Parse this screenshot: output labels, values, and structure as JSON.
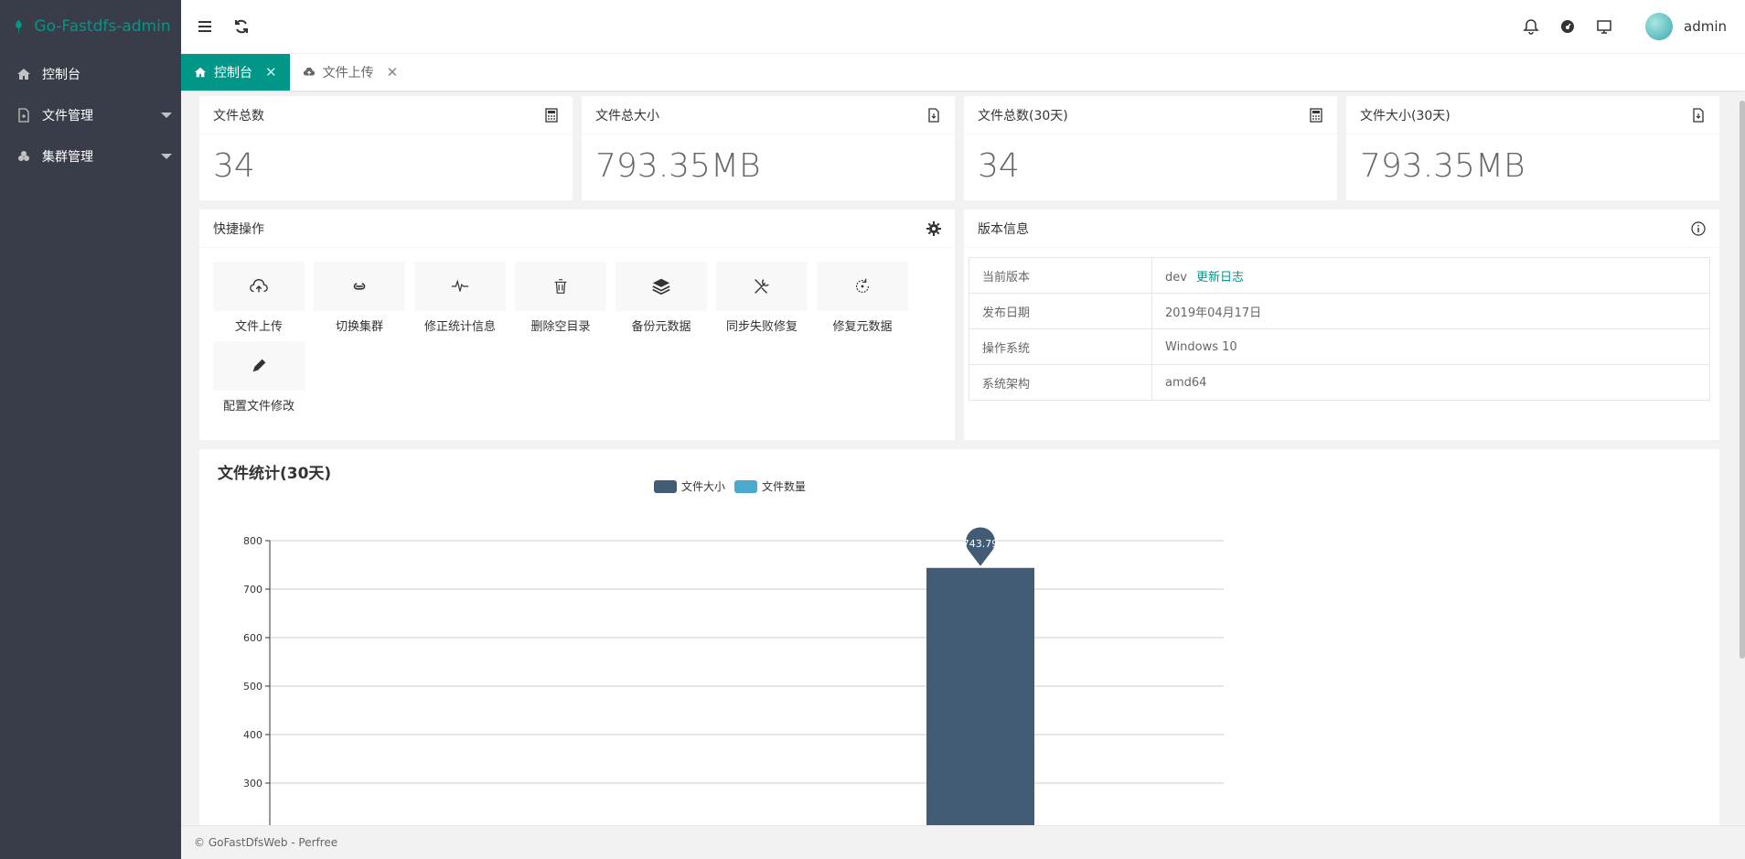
{
  "app": {
    "title": "Go-Fastdfs-admin"
  },
  "sidebar": {
    "items": [
      {
        "label": "控制台",
        "icon": "home-icon"
      },
      {
        "label": "文件管理",
        "icon": "file-icon",
        "expandable": true
      },
      {
        "label": "集群管理",
        "icon": "cluster-icon",
        "expandable": true
      }
    ]
  },
  "header": {
    "user": "admin"
  },
  "tabs": [
    {
      "label": "控制台",
      "active": true
    },
    {
      "label": "文件上传",
      "active": false
    }
  ],
  "stats": [
    {
      "label": "文件总数",
      "value": "34",
      "icon": "calculator-icon"
    },
    {
      "label": "文件总大小",
      "value": "793.35MB",
      "icon": "file-size-icon"
    },
    {
      "label": "文件总数(30天)",
      "value": "34",
      "icon": "calculator-icon"
    },
    {
      "label": "文件大小(30天)",
      "value": "793.35MB",
      "icon": "file-size-icon"
    }
  ],
  "quick": {
    "title": "快捷操作",
    "actions": [
      {
        "label": "文件上传",
        "icon": "cloud-upload-icon"
      },
      {
        "label": "切换集群",
        "icon": "link-icon"
      },
      {
        "label": "修正统计信息",
        "icon": "pulse-icon"
      },
      {
        "label": "删除空目录",
        "icon": "trash-icon"
      },
      {
        "label": "备份元数据",
        "icon": "layers-icon"
      },
      {
        "label": "同步失败修复",
        "icon": "tools-icon"
      },
      {
        "label": "修复元数据",
        "icon": "refresh-circle-icon"
      },
      {
        "label": "配置文件修改",
        "icon": "edit-icon"
      }
    ]
  },
  "version": {
    "title": "版本信息",
    "rows": [
      {
        "key": "当前版本",
        "value": "dev",
        "link": "更新日志"
      },
      {
        "key": "发布日期",
        "value": "2019年04月17日"
      },
      {
        "key": "操作系统",
        "value": "Windows 10"
      },
      {
        "key": "系统架构",
        "value": "amd64"
      }
    ]
  },
  "chart_data": {
    "type": "bar",
    "title": "文件统计(30天)",
    "series": [
      {
        "name": "文件大小",
        "values": [
          743.79
        ],
        "color": "#425c75"
      },
      {
        "name": "文件数量",
        "values": [],
        "color": "#4ba8d1"
      }
    ],
    "ylim": [
      300,
      800
    ],
    "yticks": [
      800,
      700,
      600,
      500,
      400,
      300
    ],
    "markpoint_label": "743.79",
    "grid": true,
    "legend_position": "top"
  },
  "footer": {
    "text": "© GoFastDfsWeb - Perfree"
  },
  "colors": {
    "accent": "#009688",
    "sidebar": "#393d49"
  }
}
